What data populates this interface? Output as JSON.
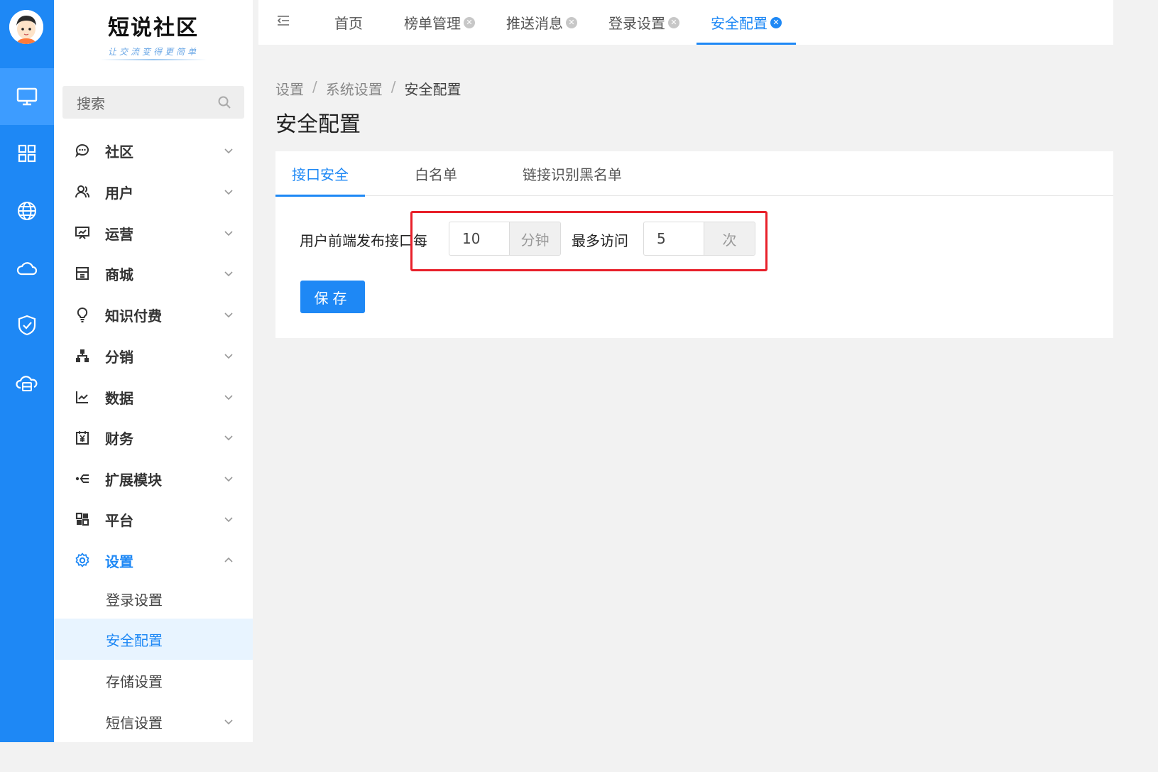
{
  "brand": {
    "title": "短说社区",
    "slogan": "让交流变得更简单"
  },
  "search": {
    "placeholder": "搜索"
  },
  "rail": {
    "icons": [
      "monitor-icon",
      "grid-icon",
      "globe-icon",
      "cloud-icon",
      "shield-check-icon",
      "cloud-server-icon"
    ],
    "active_index": 0
  },
  "sidebar": {
    "items": [
      {
        "label": "社区",
        "icon": "chat-icon"
      },
      {
        "label": "用户",
        "icon": "users-icon"
      },
      {
        "label": "运营",
        "icon": "presentation-icon"
      },
      {
        "label": "商城",
        "icon": "store-icon"
      },
      {
        "label": "知识付费",
        "icon": "lightbulb-icon"
      },
      {
        "label": "分销",
        "icon": "hierarchy-icon"
      },
      {
        "label": "数据",
        "icon": "line-chart-icon"
      },
      {
        "label": "财务",
        "icon": "finance-icon"
      },
      {
        "label": "扩展模块",
        "icon": "extension-icon"
      },
      {
        "label": "平台",
        "icon": "platform-icon"
      },
      {
        "label": "设置",
        "icon": "gear-icon",
        "expanded": true
      }
    ],
    "sub_items": [
      {
        "label": "登录设置"
      },
      {
        "label": "安全配置",
        "active": true
      },
      {
        "label": "存储设置"
      },
      {
        "label": "短信设置"
      }
    ]
  },
  "tabs": [
    {
      "label": "首页",
      "closable": false
    },
    {
      "label": "榜单管理",
      "closable": true
    },
    {
      "label": "推送消息",
      "closable": true
    },
    {
      "label": "登录设置",
      "closable": true
    },
    {
      "label": "安全配置",
      "closable": true,
      "active": true
    }
  ],
  "breadcrumb": [
    "设置",
    "系统设置",
    "安全配置"
  ],
  "page_title": "安全配置",
  "content_tabs": [
    {
      "label": "接口安全",
      "active": true
    },
    {
      "label": "白名单"
    },
    {
      "label": "链接识别黑名单"
    }
  ],
  "form": {
    "prefix_label": "用户前端发布接口每",
    "minutes_value": "10",
    "minutes_unit": "分钟",
    "max_label": "最多访问",
    "times_value": "5",
    "times_unit": "次",
    "save_label": "保存"
  },
  "colors": {
    "primary": "#1e88f5",
    "highlight": "#e8202a"
  }
}
